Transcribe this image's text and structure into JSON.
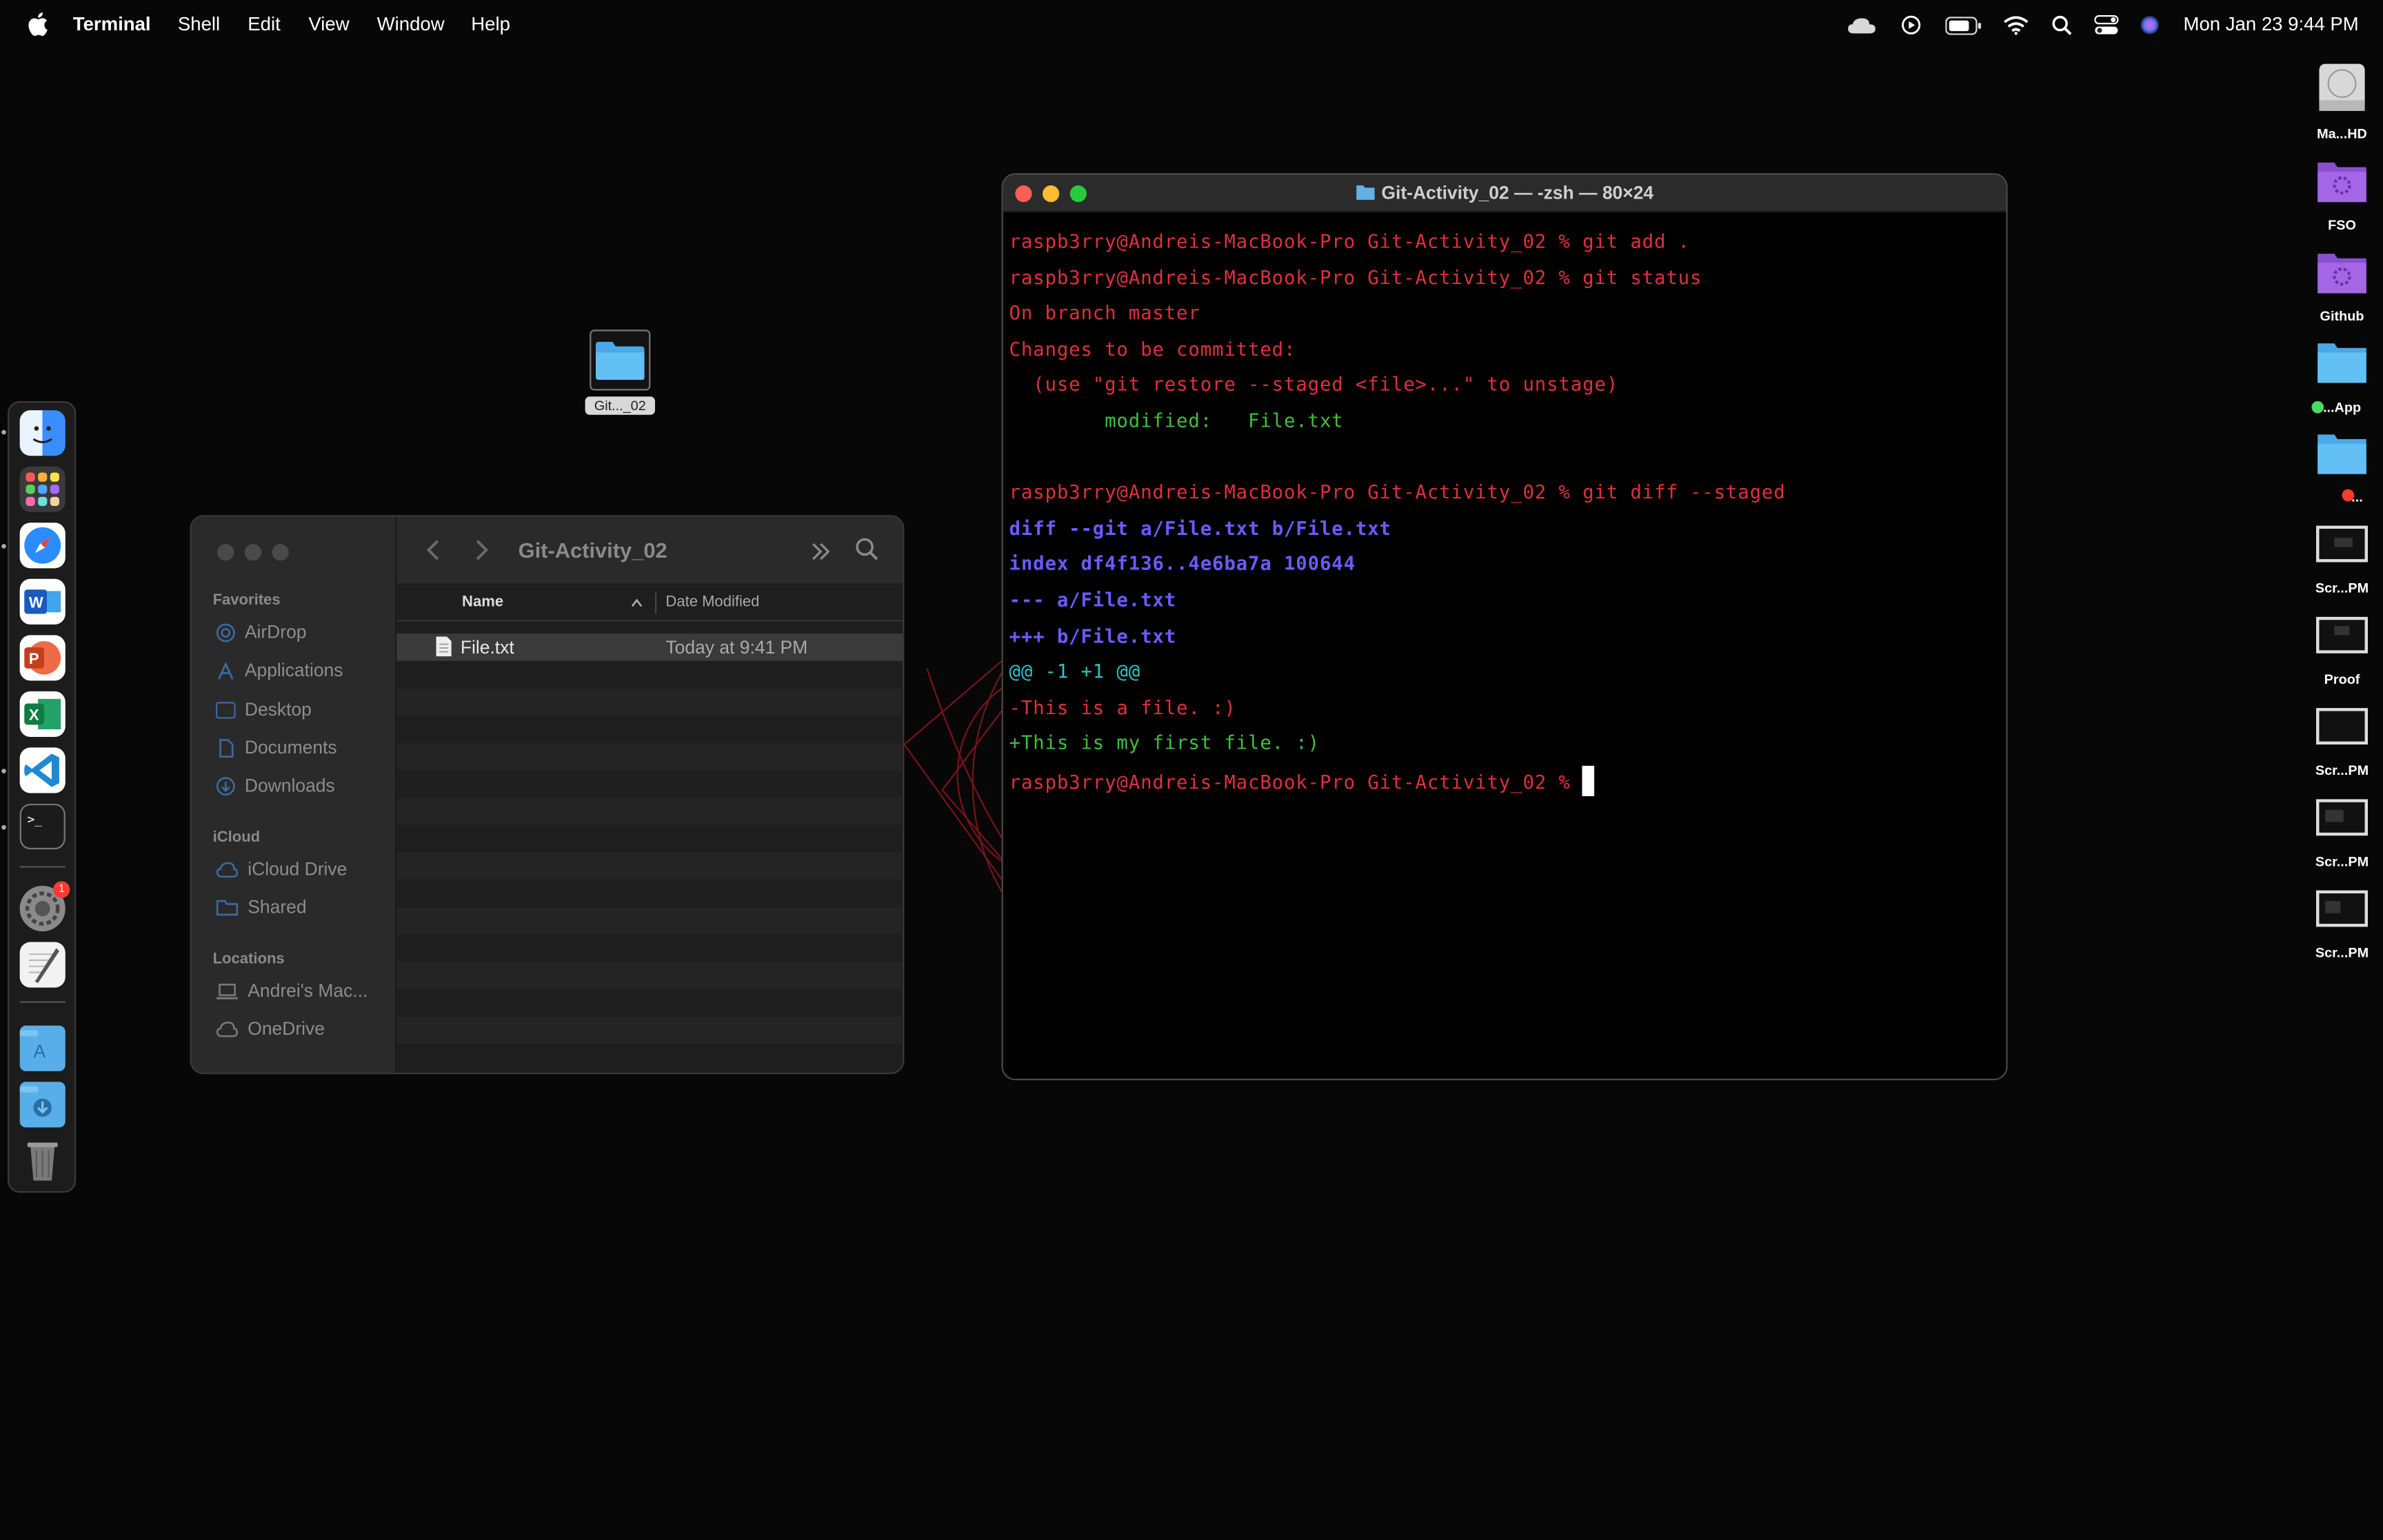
{
  "menubar": {
    "app_name": "Terminal",
    "menus": [
      "Shell",
      "Edit",
      "View",
      "Window",
      "Help"
    ],
    "clock": "Mon Jan 23  9:44 PM",
    "status_icons": [
      "icloud-icon",
      "play-icon",
      "battery-icon",
      "wifi-icon",
      "search-icon",
      "control-center-icon",
      "siri-icon"
    ]
  },
  "dock": {
    "items": [
      "finder-icon",
      "launchpad-icon",
      "safari-icon",
      "word-icon",
      "powerpoint-icon",
      "excel-icon",
      "vscode-icon",
      "terminal-icon",
      "system-settings-icon",
      "textedit-icon",
      "applications-folder-icon",
      "downloads-folder-icon",
      "trash-icon"
    ],
    "badge": "1"
  },
  "desktop": {
    "folder_label": "Git..._02",
    "right_icons": [
      {
        "label": "Ma...HD",
        "icon": "hard-drive-icon"
      },
      {
        "label": "FSO",
        "icon": "purple-folder-icon"
      },
      {
        "label": "Github",
        "icon": "purple-folder-icon"
      },
      {
        "label": "...App",
        "icon": "folder-icon"
      },
      {
        "label": "...",
        "icon": "folder-icon"
      },
      {
        "label": "Scr...PM",
        "icon": "screenshot-icon"
      },
      {
        "label": "Proof",
        "icon": "screenshot-icon"
      },
      {
        "label": "Scr...PM",
        "icon": "screenshot-icon"
      },
      {
        "label": "Scr...PM",
        "icon": "screenshot-icon"
      },
      {
        "label": "Scr...PM",
        "icon": "screenshot-icon"
      }
    ]
  },
  "finder": {
    "title": "Git-Activity_02",
    "sidebar": {
      "favorites_heading": "Favorites",
      "favorites": [
        "AirDrop",
        "Applications",
        "Desktop",
        "Documents",
        "Downloads"
      ],
      "icloud_heading": "iCloud",
      "icloud": [
        "iCloud Drive",
        "Shared"
      ],
      "locations_heading": "Locations",
      "locations": [
        "Andrei's Mac...",
        "OneDrive"
      ]
    },
    "columns": {
      "name": "Name",
      "date": "Date Modified"
    },
    "files": [
      {
        "name": "File.txt",
        "date": "Today at 9:41 PM"
      }
    ]
  },
  "terminal": {
    "title": "Git-Activity_02 — -zsh — 80×24",
    "lines": [
      {
        "text": "raspb3rry@Andreis-MacBook-Pro Git-Activity_02 % git add .",
        "color": "red"
      },
      {
        "text": "raspb3rry@Andreis-MacBook-Pro Git-Activity_02 % git status",
        "color": "red"
      },
      {
        "text": "On branch master",
        "color": "red"
      },
      {
        "text": "Changes to be committed:",
        "color": "red"
      },
      {
        "text": "  (use \"git restore --staged <file>...\" to unstage)",
        "color": "red"
      },
      {
        "text": "        modified:   File.txt",
        "color": "green"
      },
      {
        "text": "",
        "color": "red"
      },
      {
        "text": "raspb3rry@Andreis-MacBook-Pro Git-Activity_02 % git diff --staged",
        "color": "red"
      },
      {
        "text": "diff --git a/File.txt b/File.txt",
        "color": "blue"
      },
      {
        "text": "index df4f136..4e6ba7a 100644",
        "color": "blue"
      },
      {
        "text": "--- a/File.txt",
        "color": "blue"
      },
      {
        "text": "+++ b/File.txt",
        "color": "blue"
      },
      {
        "text": "@@ -1 +1 @@",
        "color": "cyan"
      },
      {
        "text": "-This is a file. :)",
        "color": "red"
      },
      {
        "text": "+This is my first file. :)",
        "color": "green"
      },
      {
        "text": "raspb3rry@Andreis-MacBook-Pro Git-Activity_02 % ",
        "color": "red",
        "cursor": true
      }
    ]
  }
}
